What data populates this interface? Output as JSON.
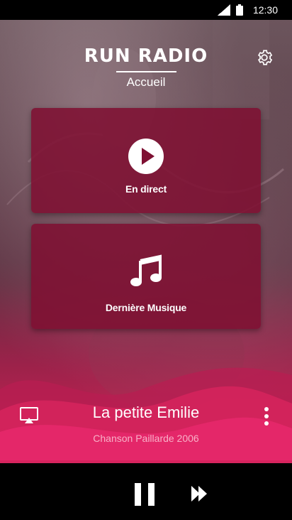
{
  "status_bar": {
    "time": "12:30",
    "icons": [
      "signal-icon",
      "battery-icon"
    ]
  },
  "header": {
    "logo": "RUN RADIO",
    "subtitle": "Accueil",
    "settings_icon": "gear-icon"
  },
  "cards": [
    {
      "label": "En direct",
      "icon": "play-circle-icon"
    },
    {
      "label": "Dernière Musique",
      "icon": "music-note-icon"
    }
  ],
  "now_playing": {
    "title": "La petite Emilie",
    "subtitle": "Chanson Paillarde 2006",
    "cast_icon": "cast-icon",
    "more_icon": "more-vertical-icon"
  },
  "player": {
    "pause_icon": "pause-icon",
    "next_icon": "fast-forward-icon"
  },
  "colors": {
    "card": "#7e1032",
    "accent": "#d8245e",
    "player_bar": "#000000"
  }
}
